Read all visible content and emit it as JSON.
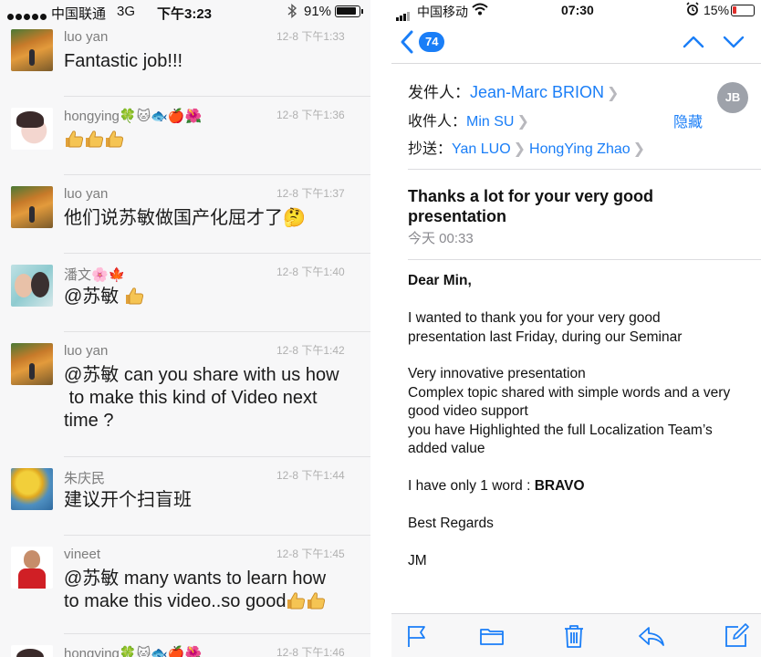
{
  "left_status": {
    "carrier": "中国联通",
    "network": "3G",
    "time": "下午3:23",
    "battery": "91%"
  },
  "comments": [
    {
      "name": "luo yan",
      "date": "12-8 下午1:33",
      "text": "Fantastic job!!!",
      "avatar": "tree"
    },
    {
      "name": "hongying🍀🐱🐟🍎🌺",
      "date": "12-8 下午1:36",
      "text": "",
      "thumbs": 3,
      "avatar": "sleep"
    },
    {
      "name": "luo yan",
      "date": "12-8 下午1:37",
      "text": "他们说苏敏做国产化屈才了🤔",
      "avatar": "tree"
    },
    {
      "name": "潘文🌸🍁",
      "date": "12-8 下午1:40",
      "text": "@苏敏 ",
      "thumbs": 1,
      "avatar": "couple"
    },
    {
      "name": "luo yan",
      "date": "12-8 下午1:42",
      "text": "@苏敏 can you share with us how\n to make this kind of Video next\ntime ?",
      "avatar": "tree"
    },
    {
      "name": "朱庆民",
      "date": "12-8 下午1:44",
      "text": "建议开个扫盲班",
      "avatar": "yellow"
    },
    {
      "name": "vineet",
      "date": "12-8 下午1:45",
      "text": "@苏敏 many wants to learn how\nto make this video..so good",
      "thumbs": 2,
      "avatar": "man"
    },
    {
      "name": "hongying🍀🐱🐟🍎🌺",
      "date": "12-8 下午1:46",
      "text": "",
      "avatar": "sleep"
    }
  ],
  "right_status": {
    "carrier": "中国移动",
    "time": "07:30",
    "battery": "15%"
  },
  "nav": {
    "count": "74"
  },
  "email": {
    "from_label": "发件人：",
    "from": "Jean-Marc BRION",
    "to_label": "收件人：",
    "to": "Min SU",
    "hide": "隐藏",
    "cc_label": "抄送：",
    "cc": [
      "Yan LUO",
      "HongYing Zhao"
    ],
    "avatar_initials": "JB",
    "subject": "Thanks a lot for your very good presentation",
    "date": "今天 00:33",
    "greeting": "Dear Min,",
    "paragraph1": "I wanted to thank you for your very good presentation last Friday, during our Seminar",
    "paragraph2": "Very innovative presentation\nComplex topic shared with simple words and a very good video support\nyou have Highlighted the full Localization Team’s added value",
    "word_prefix": "I have only 1 word : ",
    "word": "BRAVO",
    "regards": "Best Regards",
    "signature": "JM"
  },
  "toolbar": [
    "flag-icon",
    "folder-icon",
    "trash-icon",
    "reply-icon",
    "compose-icon"
  ],
  "colors": {
    "accent": "#1a7ef7",
    "battery_low": "#e0302c"
  }
}
